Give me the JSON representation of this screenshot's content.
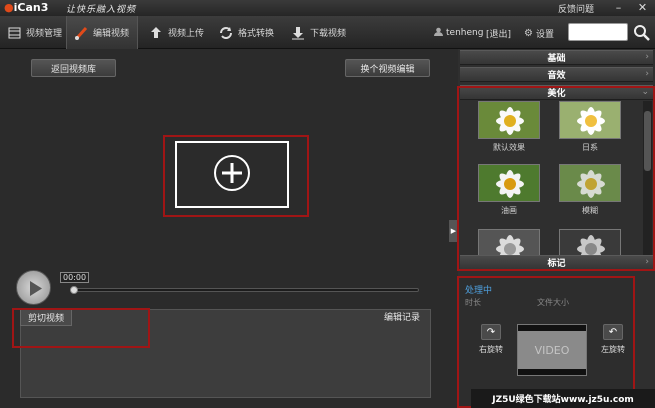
{
  "titlebar": {
    "logo_text": "iCan3",
    "slogan": "让快乐融入视频",
    "feedback": "反馈问题"
  },
  "menubar": {
    "tabs": [
      {
        "label": "视频管理",
        "icon": "film-icon"
      },
      {
        "label": "编辑视频",
        "icon": "brush-icon"
      },
      {
        "label": "视频上传",
        "icon": "upload-icon"
      },
      {
        "label": "格式转换",
        "icon": "convert-icon"
      },
      {
        "label": "下载视频",
        "icon": "download-icon"
      }
    ],
    "active_tab": "编辑视频",
    "username": "tenheng",
    "logout": "[退出]",
    "settings": "设置"
  },
  "editor": {
    "back_button": "返回视频库",
    "switch_button": "换个视频编辑",
    "time": "00:00",
    "clip_tab": "剪切视频",
    "edit_log": "编辑记录"
  },
  "right_panel": {
    "sections": {
      "basic": "基础",
      "audio": "音效",
      "beautify": "美化",
      "mark": "标记"
    },
    "effects": [
      {
        "label": "默认效果"
      },
      {
        "label": "日系"
      },
      {
        "label": "油画"
      },
      {
        "label": "模糊"
      },
      {
        "label": ""
      },
      {
        "label": ""
      }
    ],
    "processing": {
      "title": "处理中",
      "duration_label": "时长",
      "filesize_label": "文件大小",
      "rotate_right": "右旋转",
      "rotate_left": "左旋转",
      "video_placeholder": "VIDEO"
    }
  },
  "watermark": "JZ5U绿色下载站www.jz5u.com",
  "colors": {
    "background": "#2b2b2b",
    "highlight_red": "#a01515",
    "processing_blue": "#4fa1e0"
  }
}
